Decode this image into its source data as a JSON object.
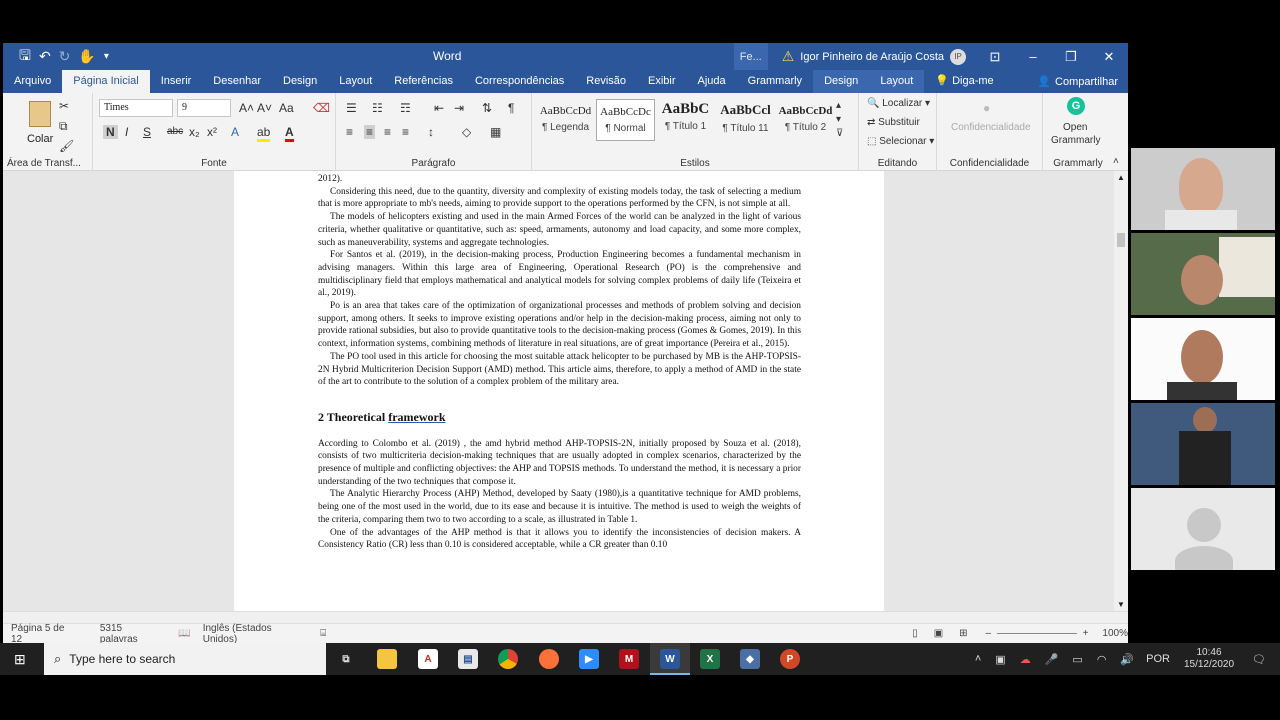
{
  "app": {
    "name": "Word",
    "user": "Igor Pinheiro de Araújo Costa",
    "initials": "IP",
    "fe": "Fe..."
  },
  "tabs": [
    "Arquivo",
    "Página Inicial",
    "Inserir",
    "Desenhar",
    "Design",
    "Layout",
    "Referências",
    "Correspondências",
    "Revisão",
    "Exibir",
    "Ajuda",
    "Grammarly"
  ],
  "context_tabs": [
    "Design",
    "Layout"
  ],
  "tell_me": "Diga-me",
  "share": "Compartilhar",
  "ribbon": {
    "clipboard": {
      "paste": "Colar",
      "label": "Área de Transf..."
    },
    "font": {
      "name": "Times",
      "size": "9",
      "label": "Fonte",
      "bold": "N",
      "italic": "I",
      "underline": "S",
      "strike": "abc",
      "sub": "x₂",
      "sup": "x²"
    },
    "paragraph": {
      "label": "Parágrafo"
    },
    "styles": {
      "label": "Estilos",
      "items": [
        {
          "prev": "AaBbCcDd",
          "name": "¶ Legenda"
        },
        {
          "prev": "AaBbCcDc",
          "name": "¶ Normal"
        },
        {
          "prev": "AaBbC",
          "name": "¶ Título 1"
        },
        {
          "prev": "AaBbCcl",
          "name": "¶ Título 11"
        },
        {
          "prev": "AaBbCcDd",
          "name": "¶ Título 2"
        }
      ]
    },
    "editing": {
      "label": "Editando",
      "find": "Localizar",
      "replace": "Substituir",
      "select": "Selecionar"
    },
    "sensitivity": {
      "btn": "Confidencialidade",
      "label": "Confidencialidade"
    },
    "grammarly": {
      "btn1": "Open",
      "btn2": "Grammarly",
      "label": "Grammarly"
    }
  },
  "document": {
    "p0": "2012).",
    "p1": "Considering this need, due to the quantity, diversity and complexity of existing models today, the task of selecting a medium that is more appropriate to mb's needs, aiming to provide support to the operations performed by the CFN, is not simple at all.",
    "p2": "The models of helicopters existing and used in the main Armed Forces of the world can be analyzed in the light of various criteria, whether qualitative or quantitative, such as: speed, armaments, autonomy and load capacity, and some more complex, such as maneuverability, systems and aggregate technologies.",
    "p3": "For Santos et al. (2019), in the decision-making process, Production Engineering becomes a fundamental mechanism in advising managers. Within this large area of Engineering, Operational Research (PO) is the comprehensive and multidisciplinary field that employs mathematical and analytical models for solving complex problems of daily life (Teixeira et al., 2019).",
    "p4": "Po is an area that takes care of the optimization of organizational processes and methods of problem solving and decision support, among others. It seeks to improve existing operations and/or help in the decision-making process, aiming not only to provide rational subsidies, but also to provide quantitative tools to the decision-making process (Gomes & Gomes, 2019). In this context, information systems, combining methods of literature in real situations, are of great importance (Pereira et al., 2015).",
    "p5": "The PO tool used in this article for choosing the most suitable attack helicopter to be purchased by MB is the AHP-TOPSIS-2N Hybrid Multicriterion Decision Support (AMD) method. This article aims, therefore, to apply a method of AMD in the state of the art to contribute to the solution of a complex problem of the military area.",
    "h2_num": "2 Theoretical ",
    "h2_word": "framework",
    "p6": "According to Colombo et al. (2019) , the amd hybrid method AHP-TOPSIS-2N, initially proposed by Souza et al. (2018), consists of two multicriteria decision-making techniques that are usually adopted in complex scenarios, characterized by the presence of multiple and conflicting objectives: the AHP and TOPSIS methods. To understand the method, it is necessary a prior understanding of the two techniques that compose it.",
    "p7": "The Analytic Hierarchy Process (AHP) Method, developed by Saaty (1980),is a quantitative technique for AMD problems, being one of the most used in the world, due to its ease and because it is intuitive. The method is used to weigh the weights of the criteria, comparing them two to two according to a scale, as illustrated in Table 1.",
    "p8": "One of the advantages of the AHP method is that it allows you to identify the inconsistencies of decision makers. A Consistency Ratio (CR) less than 0.10 is considered acceptable, while a CR greater than 0.10"
  },
  "status": {
    "page": "Página 5 de 12",
    "words": "5315 palavras",
    "lang": "Inglês (Estados Unidos)",
    "zoom": "100%"
  },
  "taskbar": {
    "search": "Type here to search",
    "lang": "POR",
    "time": "10:46",
    "date": "15/12/2020"
  }
}
